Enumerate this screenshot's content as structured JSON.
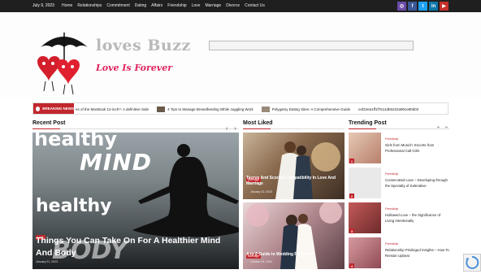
{
  "topbar": {
    "date": "July 9, 2023",
    "nav": [
      "Home",
      "Relationships",
      "Commitment",
      "Dating",
      "Affairs",
      "Friendship",
      "Love",
      "Marriage",
      "Divorce",
      "Contact Us"
    ],
    "social": [
      {
        "icon": "instagram-icon",
        "glyph": "◎",
        "color": "#6b4aa8"
      },
      {
        "icon": "facebook-icon",
        "glyph": "f",
        "color": "#3b5998"
      },
      {
        "icon": "twitter-icon",
        "glyph": "t",
        "color": "#1da1f2"
      },
      {
        "icon": "linkedin-icon",
        "glyph": "in",
        "color": "#0e76a8"
      },
      {
        "icon": "youtube-icon",
        "glyph": "▶",
        "color": "#c4302b"
      }
    ]
  },
  "header": {
    "logo_title": "loves Buzz",
    "logo_tagline": "Love Is Forever"
  },
  "ticker": {
    "label": "BREAKING NEWS",
    "items": [
      "es of the MacBook 12-inch?: A definitive Side",
      "4 Tips to Manage Breastfeeding While Juggling Work",
      "Polygamy Dating Sites: A Comprehensive Guide",
      "exf22ea1ff1f7611db5222a90ce80d02"
    ]
  },
  "sections": {
    "recent": "Recent Post",
    "most_liked": "Most Liked",
    "trending": "Trending Post"
  },
  "arrows": {
    "prev": "‹",
    "next": "›"
  },
  "feature": {
    "words": [
      "healthy",
      "MIND",
      "healthy",
      "BODY"
    ],
    "category": "Love",
    "title": "Things You Can Take On For A Healthier Mind And Body",
    "date": "January 21, 2023"
  },
  "most_liked": [
    {
      "category": "Marriage",
      "title": "Taurus And Scorpio Compatibility In Love And Marriage",
      "date": "January 10, 2023"
    },
    {
      "category": "Marriage",
      "title": "A to Z Guide to Wedding Planning!",
      "date": "October 26, 2022"
    }
  ],
  "trending": [
    {
      "num": "1",
      "category": "Friendship",
      "title": "Girls from Munich: Escorts from Professional Call Girls"
    },
    {
      "num": "2",
      "category": "Friendship",
      "title": "Consecrated Love – Developing through the Specialty of Kaleratiive"
    },
    {
      "num": "3",
      "category": "Friendship",
      "title": "Hollowed Love – the Significance of Living Intentionally"
    },
    {
      "num": "4",
      "category": "Friendship",
      "title": "Relationship Privileged Insights – How To Remain Upbeat"
    }
  ],
  "colors": {
    "accent": "#c1272d",
    "topbar": "#1f1f1f"
  }
}
